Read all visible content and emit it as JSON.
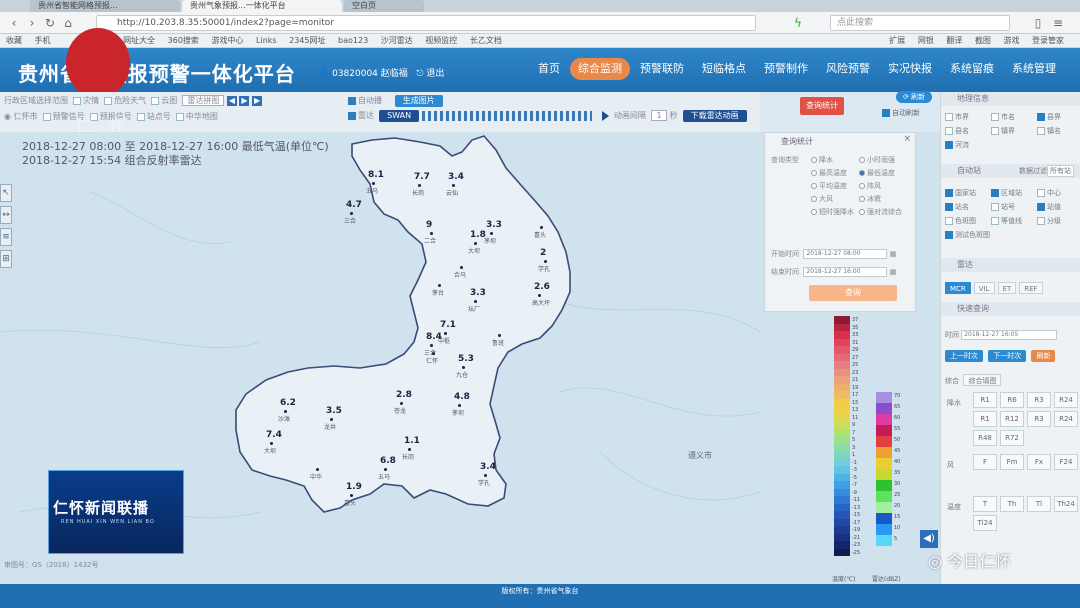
{
  "browser": {
    "tabs": [
      "贵州省智能网格预报...",
      "贵州气象预报...一体化平台",
      "空白页"
    ],
    "url": "http://10.203.8.35:50001/index2?page=monitor",
    "search_placeholder": "点此搜索",
    "bookmarks": [
      "收藏",
      "手机",
      "网址大全",
      "360搜索",
      "游戏中心",
      "Links",
      "2345网址",
      "bao123",
      "沙河雷达",
      "视频监控",
      "长乙文档"
    ],
    "bookmarks_right": [
      "扩展",
      "网银",
      "翻译",
      "截图",
      "游戏",
      "登录管家"
    ]
  },
  "header": {
    "title": "贵州省...预报预警一体化平台",
    "user_id": "03820004",
    "user_name": "赵临福",
    "logout": "退出",
    "nav": [
      {
        "label": "首页",
        "active": false
      },
      {
        "label": "综合监测",
        "active": true
      },
      {
        "label": "预警联防",
        "active": false
      },
      {
        "label": "短临格点",
        "active": false
      },
      {
        "label": "预警制作",
        "active": false
      },
      {
        "label": "风险预警",
        "active": false
      },
      {
        "label": "实况快报",
        "active": false
      },
      {
        "label": "系统留痕",
        "active": false
      },
      {
        "label": "系统管理",
        "active": false
      }
    ]
  },
  "toolbar": {
    "row1_left": "行政区域选择范围",
    "row1_items": [
      "灾情",
      "危险天气",
      "云图"
    ],
    "row1_select": "雷达拼图",
    "row2_items": [
      "预警信号",
      "预报信号",
      "站点号",
      "中华地图"
    ],
    "row2_left": "仁怀市",
    "auto_play": "自动播",
    "radar": "雷达",
    "generate_image": "生成图片",
    "swan": "SWAN",
    "anim_speed_label": "动画间隔",
    "anim_speed_value": "1",
    "anim_unit": "秒",
    "download_btn": "下载雷达动画",
    "stats_btn": "查询统计",
    "refresh_btn": "刷新",
    "auto_refresh": "自动刷新"
  },
  "map_info": {
    "line1": "2018-12-27 08:00 至 2018-12-27 16:00 最低气温(单位℃)",
    "line2": "2018-12-27 15:54 组合反射率雷达",
    "city_label": "遵义市",
    "copyright": "审图号：GS（2018）1432号"
  },
  "stations": [
    {
      "value": "8.1",
      "name": "五马"
    },
    {
      "value": "7.7",
      "name": "长岗"
    },
    {
      "value": "3.4",
      "name": "云仙"
    },
    {
      "value": "4.7",
      "name": "三合"
    },
    {
      "value": "9",
      "name": "二合"
    },
    {
      "value": "1.8",
      "name": "大坝"
    },
    {
      "value": "3.3",
      "name": "茅坝"
    },
    {
      "value": "",
      "name": "喜头"
    },
    {
      "value": "2",
      "name": "学孔"
    },
    {
      "value": "",
      "name": "茅台"
    },
    {
      "value": "",
      "name": "合马"
    },
    {
      "value": "3.3",
      "name": "坛厂"
    },
    {
      "value": "2.6",
      "name": "高大坪"
    },
    {
      "value": "7.1",
      "name": "中枢"
    },
    {
      "value": "8.4",
      "name": "三合"
    },
    {
      "value": "",
      "name": "仁怀"
    },
    {
      "value": "",
      "name": "鲁班"
    },
    {
      "value": "5.3",
      "name": "九仓"
    },
    {
      "value": "6.2",
      "name": "沙滩"
    },
    {
      "value": "3.5",
      "name": "龙井"
    },
    {
      "value": "2.8",
      "name": "苍龙"
    },
    {
      "value": "4.8",
      "name": "茅坝"
    },
    {
      "value": "7.4",
      "name": "大坝"
    },
    {
      "value": "1.1",
      "name": "长岗"
    },
    {
      "value": "",
      "name": "中华"
    },
    {
      "value": "6.8",
      "name": "五马"
    },
    {
      "value": "1.9",
      "name": "喜头"
    },
    {
      "value": "3.4",
      "name": "学孔"
    }
  ],
  "query_panel": {
    "title": "查询统计",
    "type_label": "查询类型",
    "options": [
      {
        "label": "降水",
        "checked": false
      },
      {
        "label": "小时雨强",
        "checked": false
      },
      {
        "label": "最高温度",
        "checked": false
      },
      {
        "label": "最低温度",
        "checked": true
      },
      {
        "label": "平均温度",
        "checked": false
      },
      {
        "label": "阵风",
        "checked": false
      },
      {
        "label": "大风",
        "checked": false
      },
      {
        "label": "冰雹",
        "checked": false
      },
      {
        "label": "短时强降水",
        "checked": false
      },
      {
        "label": "强对流综合",
        "checked": false
      }
    ],
    "start_label": "开始时间",
    "start_value": "2018-12-27 08:00",
    "end_label": "结束时间",
    "end_value": "2018-12-27 16:00",
    "query_btn": "查询",
    "close": "×"
  },
  "legend_temp": {
    "caption": "温度(℃)",
    "labels": [
      "37",
      "35",
      "33",
      "31",
      "29",
      "27",
      "25",
      "23",
      "21",
      "19",
      "17",
      "15",
      "13",
      "11",
      "9",
      "7",
      "5",
      "3",
      "1",
      "-1",
      "-3",
      "-5",
      "-7",
      "-9",
      "-11",
      "-13",
      "-15",
      "-17",
      "-19",
      "-21",
      "-23",
      "-25"
    ],
    "colors": [
      "#8e1a32",
      "#b8233f",
      "#d8304a",
      "#e2445a",
      "#e8566a",
      "#e46a78",
      "#e57f80",
      "#e89082",
      "#eba07a",
      "#eeaf6c",
      "#f0bd5a",
      "#f2cb4a",
      "#eed145",
      "#dfd74f",
      "#c9dd5e",
      "#b1e270",
      "#9de088",
      "#8cdca6",
      "#7ed6c2",
      "#70cfd8",
      "#60c2e4",
      "#4fb2e6",
      "#41a0e4",
      "#368cde",
      "#2d78d4",
      "#2766c6",
      "#2356b6",
      "#1f48a4",
      "#1c3c92",
      "#19307e",
      "#16256a",
      "#121a56"
    ]
  },
  "legend_radar": {
    "caption": "雷达(dBZ)",
    "labels": [
      "70",
      "65",
      "60",
      "55",
      "50",
      "45",
      "40",
      "35",
      "30",
      "25",
      "20",
      "15",
      "10",
      "5"
    ],
    "colors": [
      "#a890e0",
      "#8a4ec8",
      "#e03aa4",
      "#c41c54",
      "#e04040",
      "#f0a030",
      "#e8d030",
      "#c8d830",
      "#30c030",
      "#60e060",
      "#a0f0a0",
      "#1858c8",
      "#2898f0",
      "#58d8f8"
    ]
  },
  "right_panel": {
    "geo_title": "地理信息",
    "geo_items": [
      {
        "label": "市界",
        "checked": false
      },
      {
        "label": "市名",
        "checked": false
      },
      {
        "label": "县界",
        "checked": true
      },
      {
        "label": "县名",
        "checked": false
      },
      {
        "label": "镇界",
        "checked": false
      },
      {
        "label": "镇名",
        "checked": false
      },
      {
        "label": "河流",
        "checked": true
      }
    ],
    "auto_station_title": "自动站",
    "station_filter": "数据过滤",
    "station_all": "所有站",
    "station_items": [
      {
        "label": "国家站",
        "checked": true
      },
      {
        "label": "区域站",
        "checked": true
      },
      {
        "label": "中心",
        "checked": false
      },
      {
        "label": "站名",
        "checked": true
      },
      {
        "label": "站号",
        "checked": false
      },
      {
        "label": "站值",
        "checked": true
      },
      {
        "label": "色斑图",
        "checked": false
      },
      {
        "label": "等值线",
        "checked": false
      },
      {
        "label": "分级",
        "checked": false
      },
      {
        "label": "测试色斑图",
        "checked": true
      }
    ],
    "radar_title": "雷达",
    "radar_tabs": [
      {
        "label": "MCR",
        "active": true
      },
      {
        "label": "VIL",
        "active": false
      },
      {
        "label": "ET",
        "active": false
      },
      {
        "label": "REF",
        "active": false
      }
    ],
    "quick_query_title": "快速查询",
    "time_label": "时间",
    "time_value": "2018-12-27 16:05",
    "prev_btn": "上一时次",
    "next_btn": "下一时次",
    "refresh_btn": "刷新",
    "composite_label": "综合",
    "composite_value": "综合填图",
    "precip_label": "降水",
    "precip_cells": [
      "R1",
      "R6",
      "R3",
      "R24",
      "R1",
      "R12",
      "R3",
      "R24",
      "R48",
      "R72"
    ],
    "wind_label": "风",
    "wind_cells": [
      "F",
      "Fm",
      "Fx",
      "F24"
    ],
    "temp_label": "温度",
    "temp_cells": [
      "T",
      "Th",
      "Tl",
      "Th24",
      "Tl24"
    ]
  },
  "footer": {
    "copyright": "版权所有：贵州省气象台"
  },
  "overlays": {
    "news_title": "仁怀新闻联播",
    "news_sub": "REN HUAI XIN WEN LIAN BO",
    "watermark": "今日仁怀",
    "channel_overlay": "仁 怀"
  }
}
